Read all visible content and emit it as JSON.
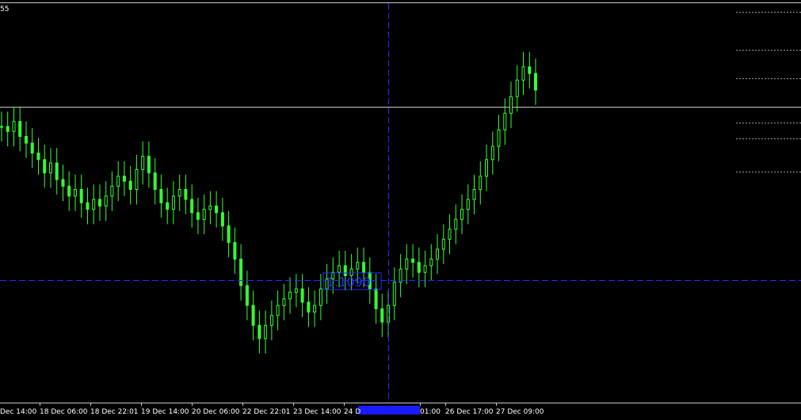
{
  "top_left_tag": "55",
  "colors": {
    "background": "#000000",
    "candle": "#33ff33",
    "gridline": "#c8c8c8",
    "crosshair": "#2a2aff",
    "xhair_label_bg": "#1a1aff",
    "axis_text": "#ffffff"
  },
  "crosshair": {
    "price_label": "1.1090"
  },
  "chart_data": {
    "type": "candlestick",
    "x_ticks": [
      "Dec 14:00",
      "18 Dec 06:00",
      "18 Dec 22:01",
      "19 Dec 14:00",
      "20 Dec 06:00",
      "22 Dec 22:01",
      "23 Dec 14:00",
      "24 D",
      "01:00",
      "26 Dec 17:00",
      "27 Dec 09:00"
    ],
    "price_series": [
      1.1178,
      1.1175,
      1.1181,
      1.1172,
      1.1168,
      1.1162,
      1.1158,
      1.115,
      1.1156,
      1.1146,
      1.1142,
      1.1136,
      1.114,
      1.1132,
      1.1128,
      1.1134,
      1.113,
      1.1136,
      1.1142,
      1.1148,
      1.1145,
      1.114,
      1.1152,
      1.116,
      1.115,
      1.114,
      1.1132,
      1.1128,
      1.1136,
      1.114,
      1.1134,
      1.1126,
      1.1122,
      1.1128,
      1.113,
      1.1126,
      1.1118,
      1.1108,
      1.1098,
      1.1082,
      1.107,
      1.1058,
      1.105,
      1.1058,
      1.1064,
      1.107,
      1.1074,
      1.1078,
      1.108,
      1.1072,
      1.1066,
      1.107,
      1.108,
      1.1086,
      1.109,
      1.1094,
      1.1088,
      1.1092,
      1.1096,
      1.109,
      1.108,
      1.1068,
      1.106,
      1.107,
      1.1084,
      1.1092,
      1.1098,
      1.1096,
      1.109,
      1.1094,
      1.1098,
      1.1104,
      1.111,
      1.1116,
      1.1122,
      1.1128,
      1.1134,
      1.114,
      1.1148,
      1.1158,
      1.1166,
      1.1176,
      1.1186,
      1.1196,
      1.1206,
      1.1214,
      1.121,
      1.12
    ]
  }
}
